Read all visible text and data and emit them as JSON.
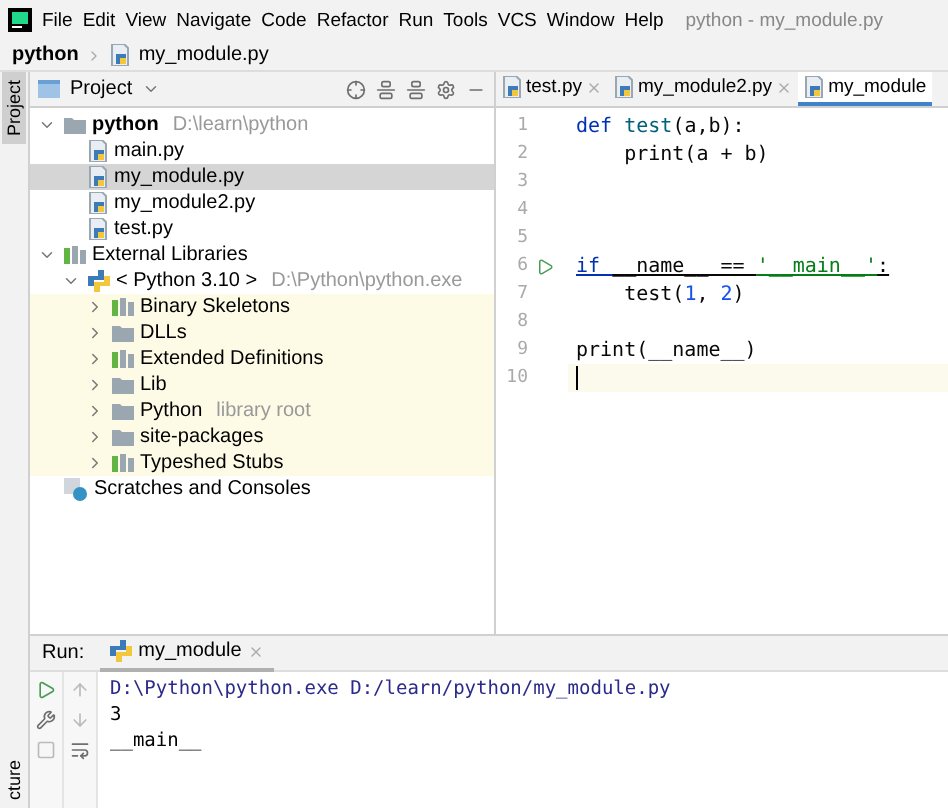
{
  "menu": {
    "items": [
      "File",
      "Edit",
      "View",
      "Navigate",
      "Code",
      "Refactor",
      "Run",
      "Tools",
      "VCS",
      "Window",
      "Help"
    ],
    "title": "python - my_module.py"
  },
  "breadcrumb": {
    "project": "python",
    "file": "my_module.py"
  },
  "side_stripe": {
    "top": "Project",
    "bottom": "cture"
  },
  "project_panel": {
    "title": "Project",
    "tree": [
      {
        "label": "python",
        "note": "D:\\learn\\python",
        "kind": "folder",
        "bold": true,
        "expanded": true,
        "selected": false,
        "tinted": false,
        "children": [
          {
            "label": "main.py",
            "kind": "python-file",
            "selected": false,
            "tinted": false
          },
          {
            "label": "my_module.py",
            "kind": "python-file",
            "selected": true,
            "tinted": false
          },
          {
            "label": "my_module2.py",
            "kind": "python-file",
            "selected": false,
            "tinted": false
          },
          {
            "label": "test.py",
            "kind": "python-file",
            "selected": false,
            "tinted": false
          }
        ]
      },
      {
        "label": "External Libraries",
        "kind": "libraries",
        "expanded": true,
        "selected": false,
        "tinted": false,
        "children": [
          {
            "label": "< Python 3.10 >",
            "note": "D:\\Python\\python.exe",
            "kind": "python-sdk",
            "expanded": true,
            "selected": false,
            "tinted": false,
            "children": [
              {
                "label": "Binary Skeletons",
                "kind": "library",
                "expanded": false,
                "selected": false,
                "tinted": true
              },
              {
                "label": "DLLs",
                "kind": "folder",
                "expanded": false,
                "selected": false,
                "tinted": true
              },
              {
                "label": "Extended Definitions",
                "kind": "library",
                "expanded": false,
                "selected": false,
                "tinted": true
              },
              {
                "label": "Lib",
                "kind": "folder",
                "expanded": false,
                "selected": false,
                "tinted": true
              },
              {
                "label": "Python",
                "note": "library root",
                "kind": "folder",
                "expanded": false,
                "selected": false,
                "tinted": true
              },
              {
                "label": "site-packages",
                "kind": "folder",
                "expanded": false,
                "selected": false,
                "tinted": true
              },
              {
                "label": "Typeshed Stubs",
                "kind": "library",
                "expanded": false,
                "selected": false,
                "tinted": true
              }
            ]
          }
        ]
      },
      {
        "label": "Scratches and Consoles",
        "kind": "scratches",
        "selected": false,
        "tinted": false
      }
    ]
  },
  "editor": {
    "tabs": [
      {
        "label": "test.py",
        "selected": false,
        "closable": true
      },
      {
        "label": "my_module2.py",
        "selected": false,
        "closable": true
      },
      {
        "label": "my_module",
        "selected": true,
        "closable": false
      }
    ],
    "lines": [
      {
        "number": "1",
        "run": false,
        "current": false,
        "tokens": [
          {
            "kind": "keyword",
            "text": "def "
          },
          {
            "kind": "func",
            "text": "test"
          },
          {
            "kind": "plain",
            "text": "(a,b):"
          }
        ]
      },
      {
        "number": "2",
        "run": false,
        "current": false,
        "tokens": [
          {
            "kind": "plain",
            "text": "    print(a + b)"
          }
        ]
      },
      {
        "number": "3",
        "run": false,
        "current": false
      },
      {
        "number": "4",
        "run": false,
        "current": false
      },
      {
        "number": "5",
        "run": false,
        "current": false
      },
      {
        "number": "6",
        "run": true,
        "current": false,
        "tokens": [
          {
            "kind": "keyword",
            "text": "if "
          },
          {
            "kind": "plain",
            "text": "__name__ == "
          },
          {
            "kind": "string",
            "text": "'__main__'"
          },
          {
            "kind": "plain",
            "text": ":"
          }
        ]
      },
      {
        "number": "7",
        "run": false,
        "current": false,
        "tokens": [
          {
            "kind": "plain",
            "text": "    test("
          },
          {
            "kind": "number",
            "text": "1"
          },
          {
            "kind": "plain",
            "text": ", "
          },
          {
            "kind": "number",
            "text": "2"
          },
          {
            "kind": "plain",
            "text": ")"
          }
        ]
      },
      {
        "number": "8",
        "run": false,
        "current": false
      },
      {
        "number": "9",
        "run": false,
        "current": false,
        "tokens": [
          {
            "kind": "plain",
            "text": "print(__name__)"
          }
        ]
      },
      {
        "number": "10",
        "run": false,
        "current": true
      }
    ]
  },
  "run_panel": {
    "label": "Run:",
    "tab": "my_module",
    "output": [
      {
        "kind": "command",
        "text": "D:\\Python\\python.exe D:/learn/python/my_module.py"
      },
      {
        "kind": "output",
        "text": "3"
      },
      {
        "kind": "output",
        "text": "__main__"
      }
    ]
  }
}
